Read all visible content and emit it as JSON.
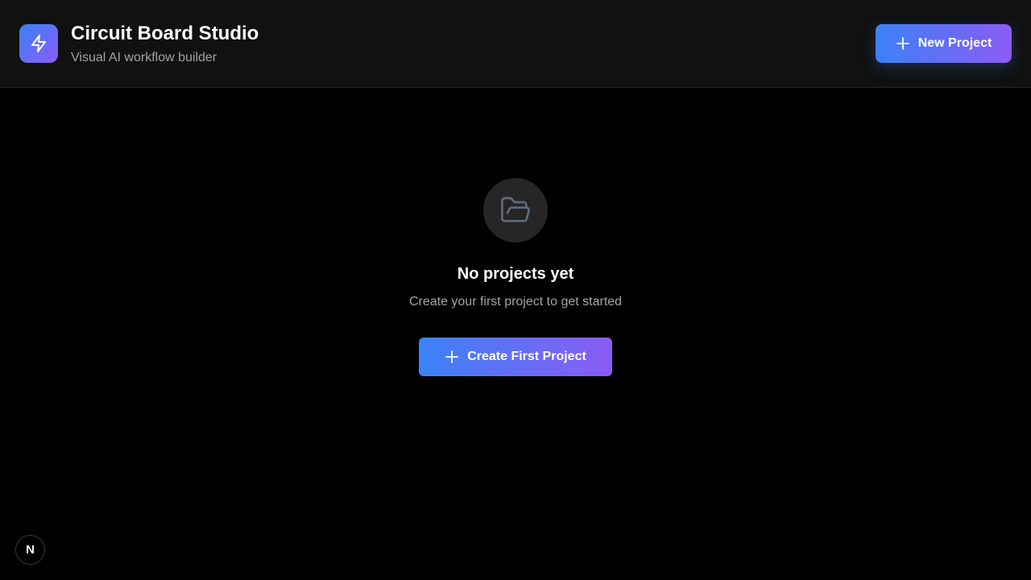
{
  "header": {
    "title": "Circuit Board Studio",
    "subtitle": "Visual AI workflow builder",
    "logo_icon": "lightning-bolt-icon",
    "new_project_label": "New Project"
  },
  "empty_state": {
    "icon": "folder-open-icon",
    "title": "No projects yet",
    "description": "Create your first project to get started",
    "cta_label": "Create First Project"
  },
  "dev_badge": {
    "letter": "N",
    "icon": "nextjs-logo-icon"
  },
  "colors": {
    "background": "#000000",
    "header_background": "#111111",
    "gradient_start": "#3b82f6",
    "gradient_end": "#8b5cf6",
    "muted_text": "#a3a3a3",
    "empty_icon_circle": "#262626"
  }
}
